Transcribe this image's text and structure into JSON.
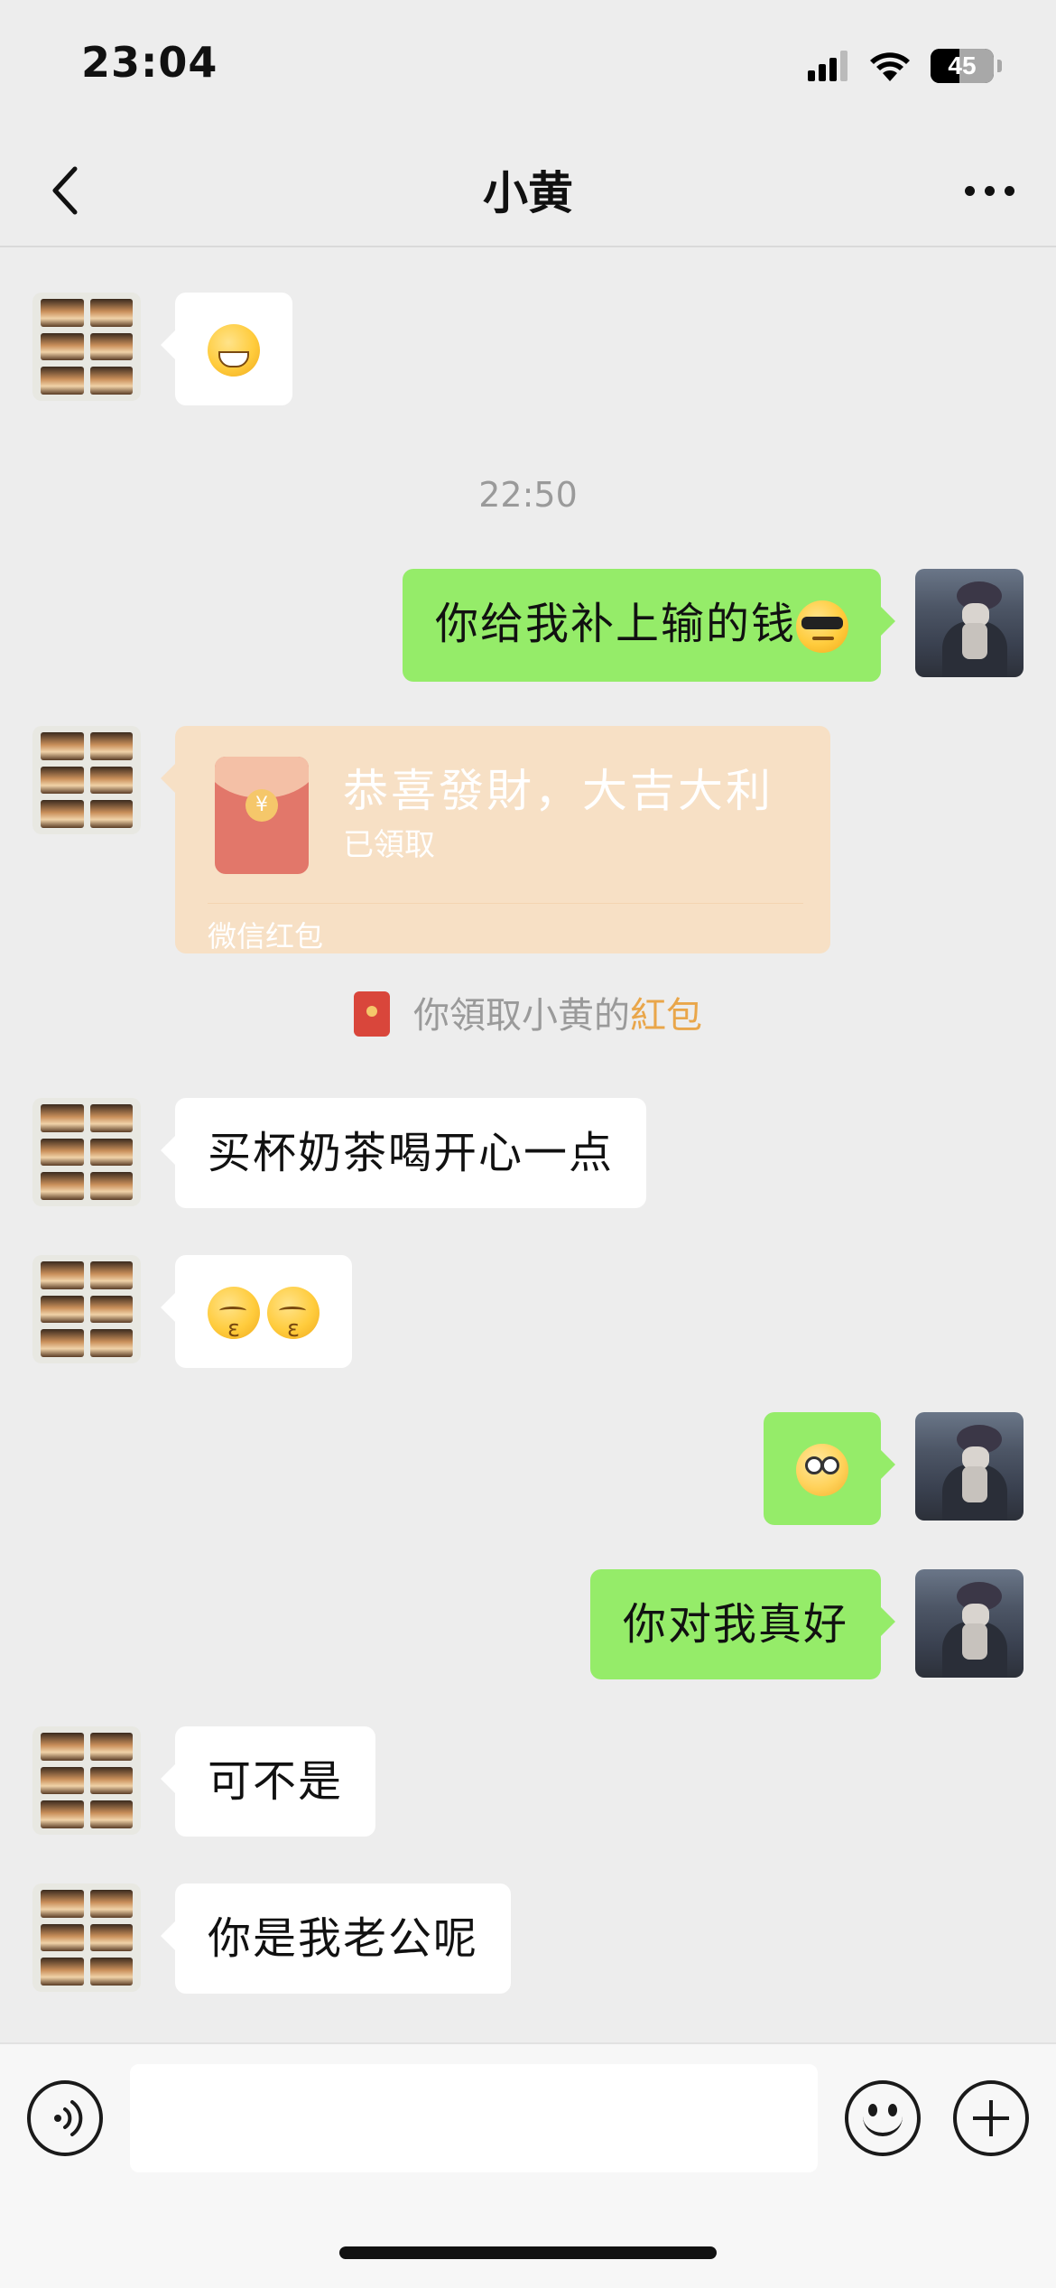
{
  "status_bar": {
    "time": "23:04",
    "battery": "45",
    "battery_level_percent": 45
  },
  "nav": {
    "title": "小黄"
  },
  "chat": {
    "timestamp": "22:50",
    "messages": [
      {
        "side": "in",
        "emoji": "grinning-emoji"
      },
      {
        "side": "out",
        "text": "你给我补上输的钱"
      },
      {
        "side": "in",
        "type": "red-packet"
      },
      {
        "side": "in",
        "text": "买杯奶茶喝开心一点"
      },
      {
        "side": "in",
        "emoji": "kissing-emoji x2"
      },
      {
        "side": "out",
        "emoji": "waving-emoji"
      },
      {
        "side": "out",
        "text": "你对我真好"
      },
      {
        "side": "in",
        "text": "可不是"
      },
      {
        "side": "in",
        "text": "你是我老公呢"
      }
    ],
    "red_packet": {
      "title": "恭喜發財，大吉大利",
      "status": "已領取",
      "label": "微信红包",
      "coin_symbol": "¥"
    },
    "system_note": {
      "prefix": "你領取小黄的",
      "link": "紅包"
    }
  },
  "input": {
    "value": ""
  },
  "colors": {
    "background": "#ededed",
    "out_bubble": "#95ec69",
    "in_bubble": "#ffffff",
    "packet": "#f7e0c5",
    "link": "#e9a64a"
  },
  "icons": [
    "back-icon",
    "more-icon",
    "signal-icon",
    "wifi-icon",
    "battery-icon",
    "voice-icon",
    "emoji-icon",
    "add-icon"
  ]
}
